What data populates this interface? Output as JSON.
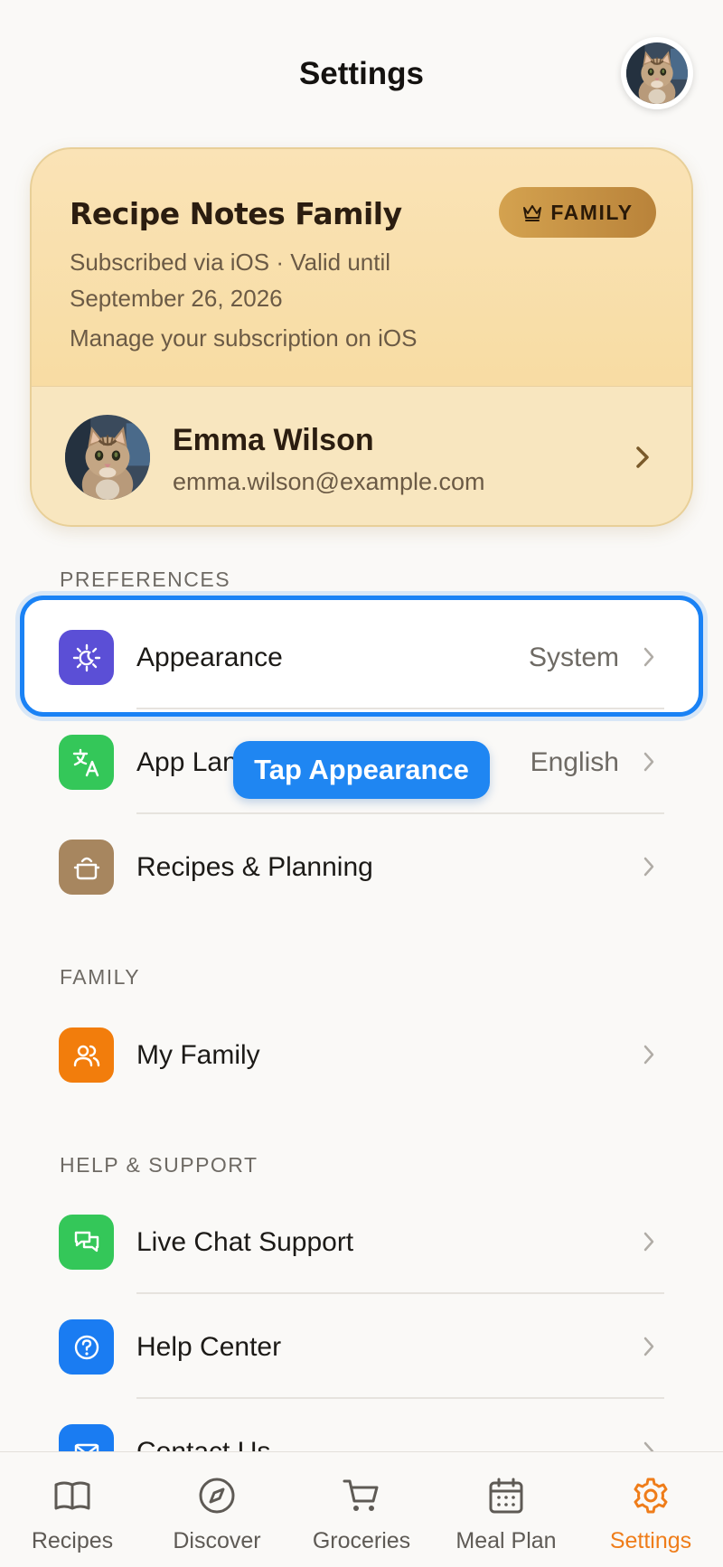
{
  "header": {
    "title": "Settings",
    "avatar": "cat-avatar"
  },
  "subscription": {
    "plan_name": "Recipe Notes Family",
    "badge_label": "FAMILY",
    "badge_icon": "crown-icon",
    "line1": "Subscribed via iOS · Valid until",
    "line2": "September 26, 2026",
    "manage": "Manage your subscription on iOS",
    "profile": {
      "name": "Emma Wilson",
      "email": "emma.wilson@example.com"
    }
  },
  "sections": {
    "preferences": {
      "label": "PREFERENCES",
      "items": [
        {
          "label": "Appearance",
          "value": "System",
          "icon": "appearance-icon",
          "color": "#5b4fd6"
        },
        {
          "label": "App Language",
          "value": "English",
          "icon": "translate-icon",
          "color": "#34c759"
        },
        {
          "label": "Recipes & Planning",
          "value": "",
          "icon": "cooking-pot-icon",
          "color": "#a7865f"
        }
      ]
    },
    "family": {
      "label": "FAMILY",
      "items": [
        {
          "label": "My Family",
          "icon": "people-icon",
          "color": "#f27d0c"
        }
      ]
    },
    "help": {
      "label": "HELP & SUPPORT",
      "items": [
        {
          "label": "Live Chat Support",
          "icon": "chat-icon",
          "color": "#34c759"
        },
        {
          "label": "Help Center",
          "icon": "question-icon",
          "color": "#1a7cf2"
        },
        {
          "label": "Contact Us",
          "icon": "mail-icon",
          "color": "#1a7cf2"
        }
      ]
    }
  },
  "tooltip": {
    "text": "Tap Appearance"
  },
  "highlight_color": "#1a82f5",
  "tabs": [
    {
      "label": "Recipes",
      "icon": "book-icon"
    },
    {
      "label": "Discover",
      "icon": "compass-icon"
    },
    {
      "label": "Groceries",
      "icon": "cart-icon"
    },
    {
      "label": "Meal Plan",
      "icon": "calendar-icon"
    },
    {
      "label": "Settings",
      "icon": "gear-icon",
      "active": true
    }
  ],
  "accent_color": "#ef7d1a"
}
